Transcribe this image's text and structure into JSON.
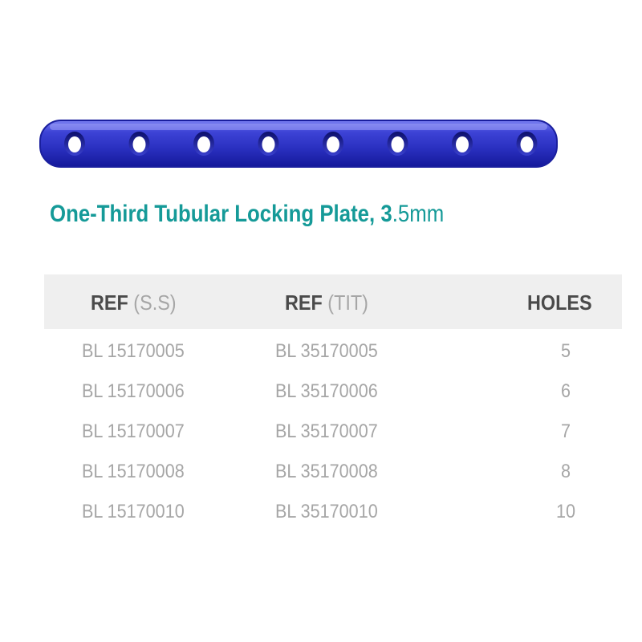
{
  "product": {
    "title_bold": "One-Third Tubular Locking Plate, 3",
    "title_light": ".5mm",
    "plate_image": {
      "icon": "bone-plate-icon",
      "hole_count": 8,
      "color": "#2f35c9"
    }
  },
  "table": {
    "headers": [
      {
        "bold": "REF",
        "light": " (S.S)"
      },
      {
        "bold": "REF",
        "light": " (TIT)"
      },
      {
        "bold": "HOLES",
        "light": ""
      }
    ],
    "rows": [
      {
        "ref_ss": "BL 15170005",
        "ref_tit": "BL 35170005",
        "holes": "5"
      },
      {
        "ref_ss": "BL 15170006",
        "ref_tit": "BL 35170006",
        "holes": "6"
      },
      {
        "ref_ss": "BL 15170007",
        "ref_tit": "BL 35170007",
        "holes": "7"
      },
      {
        "ref_ss": "BL 15170008",
        "ref_tit": "BL 35170008",
        "holes": "8"
      },
      {
        "ref_ss": "BL 15170010",
        "ref_tit": "BL 35170010",
        "holes": "10"
      }
    ]
  }
}
